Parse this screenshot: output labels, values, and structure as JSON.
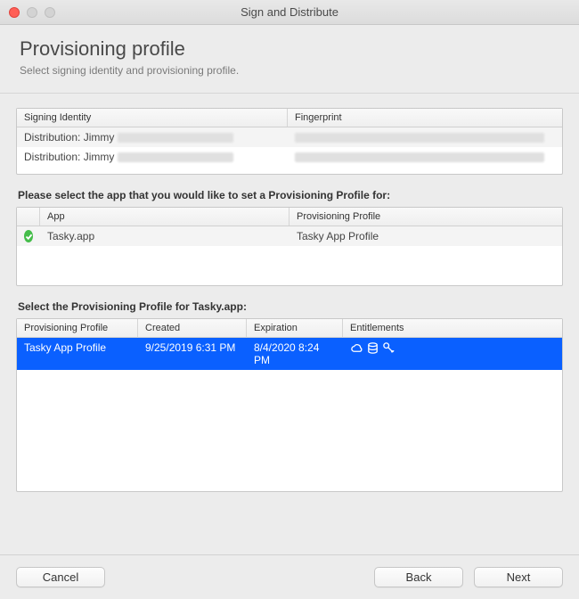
{
  "window": {
    "title": "Sign and Distribute"
  },
  "header": {
    "title": "Provisioning profile",
    "subtitle": "Select signing identity and provisioning profile."
  },
  "signing": {
    "columns": {
      "identity": "Signing Identity",
      "fingerprint": "Fingerprint"
    },
    "rows": [
      {
        "identity": "Distribution: Jimmy"
      },
      {
        "identity": "Distribution: Jimmy"
      }
    ]
  },
  "apps": {
    "label": "Please select the app that you would like to set a Provisioning Profile for:",
    "columns": {
      "app": "App",
      "profile": "Provisioning Profile"
    },
    "rows": [
      {
        "app": "Tasky.app",
        "profile": "Tasky App Profile"
      }
    ]
  },
  "profiles": {
    "label": "Select the Provisioning Profile for Tasky.app:",
    "columns": {
      "profile": "Provisioning Profile",
      "created": "Created",
      "expiration": "Expiration",
      "entitlements": "Entitlements"
    },
    "rows": [
      {
        "profile": "Tasky App Profile",
        "created": "9/25/2019 6:31 PM",
        "expiration": "8/4/2020 8:24 PM"
      }
    ]
  },
  "footer": {
    "cancel": "Cancel",
    "back": "Back",
    "next": "Next"
  }
}
